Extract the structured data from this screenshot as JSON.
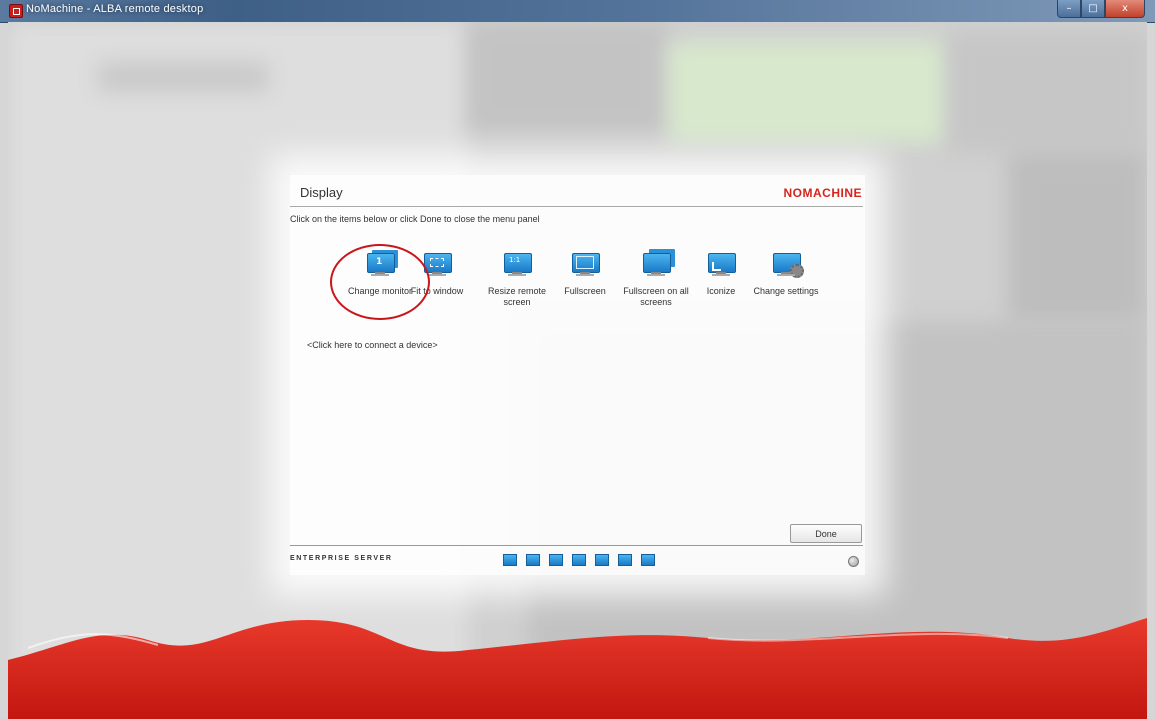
{
  "window": {
    "title": "NoMachine - ALBA remote desktop",
    "controls": {
      "minimize": "–",
      "maximize": "□",
      "close": "x"
    }
  },
  "panel": {
    "title": "Display",
    "brand": "NOMACHINE",
    "instruction": "Click on the items below or click Done to close the menu panel",
    "items": [
      {
        "label": "Change monitor",
        "icon": "monitor-1-icon",
        "badge": "1"
      },
      {
        "label": "Fit to window",
        "icon": "fit-to-window-icon"
      },
      {
        "label": "Resize remote screen",
        "icon": "resize-1to1-icon",
        "badge": "1:1"
      },
      {
        "label": "Fullscreen",
        "icon": "fullscreen-icon"
      },
      {
        "label": "Fullscreen on all screens",
        "icon": "fullscreen-all-icon"
      },
      {
        "label": "Iconize",
        "icon": "iconize-icon"
      },
      {
        "label": "Change settings",
        "icon": "settings-monitor-icon"
      }
    ],
    "connect_device": "<Click here to connect a device>",
    "done_label": "Done",
    "edition": "ENTERPRISE SERVER"
  },
  "colors": {
    "brand_red": "#d3261e",
    "icon_blue": "#1a7ac6"
  }
}
